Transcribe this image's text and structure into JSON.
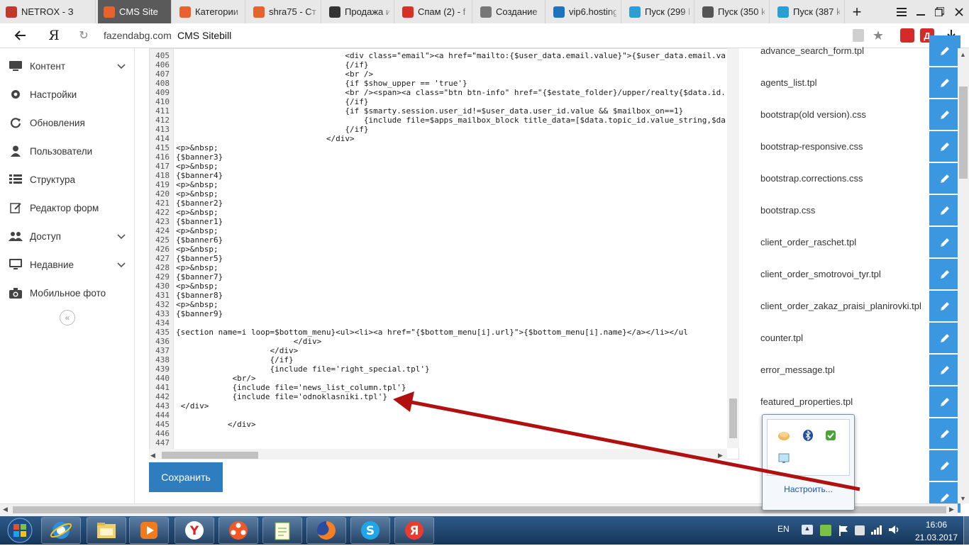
{
  "browser": {
    "tabs": [
      {
        "label": "NETROX - З",
        "icon": "netrox-icon",
        "color": "#c0392b"
      },
      {
        "label": "CMS Site",
        "icon": "sitebill-icon",
        "color": "#e8632b",
        "active": true
      },
      {
        "label": "Категории",
        "icon": "sitebill-icon",
        "color": "#e8632b"
      },
      {
        "label": "shra75 - Стр",
        "icon": "sitebill-icon",
        "color": "#e8632b"
      },
      {
        "label": "Продажа и",
        "icon": "house-icon",
        "color": "#333333"
      },
      {
        "label": "Спам (2) - f",
        "icon": "gmail-icon",
        "color": "#d93025"
      },
      {
        "label": "Создание п",
        "icon": "gear-icon",
        "color": "#777777"
      },
      {
        "label": "vip6.hosting",
        "icon": "hosting-icon",
        "color": "#1e73be"
      },
      {
        "label": "Пуск (299 k",
        "icon": "start-icon",
        "color": "#2a9fd6"
      },
      {
        "label": "Пуск (350 k",
        "icon": "loading-icon",
        "color": "#555555"
      },
      {
        "label": "Пуск (387 k",
        "icon": "start-icon",
        "color": "#2a9fd6"
      }
    ],
    "new_tab": "+",
    "address": {
      "domain": "fazendabg.com",
      "title": "CMS Sitebill"
    },
    "yandex_logo": "Я"
  },
  "sidebar": {
    "items": [
      {
        "label": "Контент",
        "icon": "content-icon",
        "expandable": true
      },
      {
        "label": "Настройки",
        "icon": "gear-icon",
        "expandable": false
      },
      {
        "label": "Обновления",
        "icon": "refresh-icon",
        "expandable": false
      },
      {
        "label": "Пользователи",
        "icon": "user-icon",
        "expandable": false
      },
      {
        "label": "Структура",
        "icon": "structure-icon",
        "expandable": false
      },
      {
        "label": "Редактор форм",
        "icon": "form-editor-icon",
        "expandable": false
      },
      {
        "label": "Доступ",
        "icon": "users-icon",
        "expandable": true
      },
      {
        "label": "Недавние",
        "icon": "monitor-icon",
        "expandable": true
      },
      {
        "label": "Мобильное фото",
        "icon": "camera-icon",
        "expandable": false
      }
    ],
    "collapse": "«"
  },
  "editor": {
    "lines": [
      {
        "n": "405",
        "t": "                                    <div class=\"email\"><a href=\"mailto:{$user_data.email.value}\">{$user_data.email.va"
      },
      {
        "n": "406",
        "t": "                                    {/if}"
      },
      {
        "n": "407",
        "t": "                                    <br />"
      },
      {
        "n": "408",
        "t": "                                    {if $show_upper == 'true'}"
      },
      {
        "n": "409",
        "t": "                                    <br /><span><a class=\"btn btn-info\" href=\"{$estate_folder}/upper/realty{$data.id."
      },
      {
        "n": "410",
        "t": "                                    {/if}"
      },
      {
        "n": "411",
        "t": "                                    {if $smarty.session.user_id!=$user_data.user_id.value && $mailbox_on==1}"
      },
      {
        "n": "412",
        "t": "                                        {include file=$apps_mailbox_block title_data=[$data.topic_id.value_string,$da"
      },
      {
        "n": "413",
        "t": "                                    {/if}"
      },
      {
        "n": "414",
        "t": "                                </div>"
      },
      {
        "n": "415",
        "t": "<p>&nbsp;"
      },
      {
        "n": "416",
        "t": "{$banner3}"
      },
      {
        "n": "417",
        "t": "<p>&nbsp;"
      },
      {
        "n": "418",
        "t": "{$banner4}"
      },
      {
        "n": "419",
        "t": "<p>&nbsp;"
      },
      {
        "n": "420",
        "t": "<p>&nbsp;"
      },
      {
        "n": "421",
        "t": "{$banner2}"
      },
      {
        "n": "422",
        "t": "<p>&nbsp;"
      },
      {
        "n": "423",
        "t": "{$banner1}"
      },
      {
        "n": "424",
        "t": "<p>&nbsp;"
      },
      {
        "n": "425",
        "t": "{$banner6}"
      },
      {
        "n": "426",
        "t": "<p>&nbsp;"
      },
      {
        "n": "427",
        "t": "{$banner5}"
      },
      {
        "n": "428",
        "t": "<p>&nbsp;"
      },
      {
        "n": "429",
        "t": "{$banner7}"
      },
      {
        "n": "430",
        "t": "<p>&nbsp;"
      },
      {
        "n": "431",
        "t": "{$banner8}"
      },
      {
        "n": "432",
        "t": "<p>&nbsp;"
      },
      {
        "n": "433",
        "t": "{$banner9}"
      },
      {
        "n": "434",
        "t": ""
      },
      {
        "n": "435",
        "t": "{section name=i loop=$bottom_menu}<ul><li><a href=\"{$bottom_menu[i].url}\">{$bottom_menu[i].name}</a></li></ul"
      },
      {
        "n": "436",
        "t": "                         </div>"
      },
      {
        "n": "437",
        "t": "                    </div>"
      },
      {
        "n": "438",
        "t": "                    {/if}"
      },
      {
        "n": "439",
        "t": "                    {include file='right_special.tpl'}"
      },
      {
        "n": "440",
        "t": "            <br/>"
      },
      {
        "n": "441",
        "t": "            {include file='news_list_column.tpl'}"
      },
      {
        "n": "442",
        "t": "            {include file='odnoklasniki.tpl'}"
      },
      {
        "n": "443",
        "t": " </div>"
      },
      {
        "n": "444",
        "t": ""
      },
      {
        "n": "445",
        "t": "           </div>"
      },
      {
        "n": "446",
        "t": ""
      },
      {
        "n": "447",
        "t": ""
      }
    ]
  },
  "save_label": "Сохранить",
  "files": [
    "advance_search_form.tpl",
    "agents_list.tpl",
    "bootstrap(old version).css",
    "bootstrap-responsive.css",
    "bootstrap.corrections.css",
    "bootstrap.css",
    "client_order_raschet.tpl",
    "client_order_smotrovoi_tyr.tpl",
    "client_order_zakaz_praisi_planirovki.tpl",
    "counter.tpl",
    "error_message.tpl",
    "featured_properties.tpl",
    "",
    "",
    ""
  ],
  "tray_popup": {
    "customize": "Настроить..."
  },
  "taskbar": {
    "apps": [
      "ie-icon",
      "explorer-icon",
      "media-player-icon",
      "yandex-icon",
      "videos-icon",
      "notepad-icon",
      "firefox-icon",
      "skype-icon",
      "yandex-browser-icon"
    ],
    "lang": "EN",
    "time": "16:06",
    "date": "21.03.2017"
  },
  "colors": {
    "accent": "#2d7dbf",
    "edit_button": "#3a97e0",
    "arrow": "#b01010"
  }
}
